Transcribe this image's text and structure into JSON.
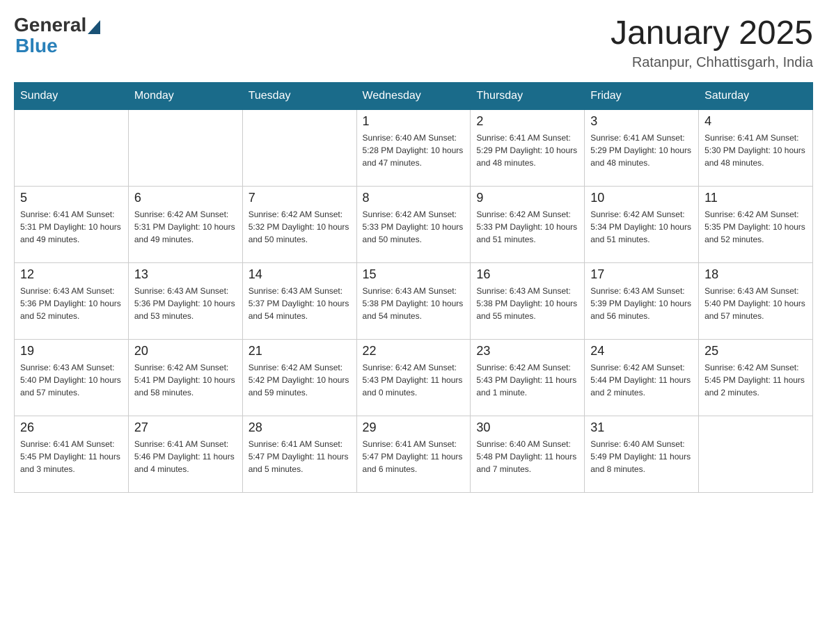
{
  "header": {
    "logo_general": "General",
    "logo_blue": "Blue",
    "month_title": "January 2025",
    "location": "Ratanpur, Chhattisgarh, India"
  },
  "days_of_week": [
    "Sunday",
    "Monday",
    "Tuesday",
    "Wednesday",
    "Thursday",
    "Friday",
    "Saturday"
  ],
  "weeks": [
    [
      {
        "day": "",
        "info": ""
      },
      {
        "day": "",
        "info": ""
      },
      {
        "day": "",
        "info": ""
      },
      {
        "day": "1",
        "info": "Sunrise: 6:40 AM\nSunset: 5:28 PM\nDaylight: 10 hours\nand 47 minutes."
      },
      {
        "day": "2",
        "info": "Sunrise: 6:41 AM\nSunset: 5:29 PM\nDaylight: 10 hours\nand 48 minutes."
      },
      {
        "day": "3",
        "info": "Sunrise: 6:41 AM\nSunset: 5:29 PM\nDaylight: 10 hours\nand 48 minutes."
      },
      {
        "day": "4",
        "info": "Sunrise: 6:41 AM\nSunset: 5:30 PM\nDaylight: 10 hours\nand 48 minutes."
      }
    ],
    [
      {
        "day": "5",
        "info": "Sunrise: 6:41 AM\nSunset: 5:31 PM\nDaylight: 10 hours\nand 49 minutes."
      },
      {
        "day": "6",
        "info": "Sunrise: 6:42 AM\nSunset: 5:31 PM\nDaylight: 10 hours\nand 49 minutes."
      },
      {
        "day": "7",
        "info": "Sunrise: 6:42 AM\nSunset: 5:32 PM\nDaylight: 10 hours\nand 50 minutes."
      },
      {
        "day": "8",
        "info": "Sunrise: 6:42 AM\nSunset: 5:33 PM\nDaylight: 10 hours\nand 50 minutes."
      },
      {
        "day": "9",
        "info": "Sunrise: 6:42 AM\nSunset: 5:33 PM\nDaylight: 10 hours\nand 51 minutes."
      },
      {
        "day": "10",
        "info": "Sunrise: 6:42 AM\nSunset: 5:34 PM\nDaylight: 10 hours\nand 51 minutes."
      },
      {
        "day": "11",
        "info": "Sunrise: 6:42 AM\nSunset: 5:35 PM\nDaylight: 10 hours\nand 52 minutes."
      }
    ],
    [
      {
        "day": "12",
        "info": "Sunrise: 6:43 AM\nSunset: 5:36 PM\nDaylight: 10 hours\nand 52 minutes."
      },
      {
        "day": "13",
        "info": "Sunrise: 6:43 AM\nSunset: 5:36 PM\nDaylight: 10 hours\nand 53 minutes."
      },
      {
        "day": "14",
        "info": "Sunrise: 6:43 AM\nSunset: 5:37 PM\nDaylight: 10 hours\nand 54 minutes."
      },
      {
        "day": "15",
        "info": "Sunrise: 6:43 AM\nSunset: 5:38 PM\nDaylight: 10 hours\nand 54 minutes."
      },
      {
        "day": "16",
        "info": "Sunrise: 6:43 AM\nSunset: 5:38 PM\nDaylight: 10 hours\nand 55 minutes."
      },
      {
        "day": "17",
        "info": "Sunrise: 6:43 AM\nSunset: 5:39 PM\nDaylight: 10 hours\nand 56 minutes."
      },
      {
        "day": "18",
        "info": "Sunrise: 6:43 AM\nSunset: 5:40 PM\nDaylight: 10 hours\nand 57 minutes."
      }
    ],
    [
      {
        "day": "19",
        "info": "Sunrise: 6:43 AM\nSunset: 5:40 PM\nDaylight: 10 hours\nand 57 minutes."
      },
      {
        "day": "20",
        "info": "Sunrise: 6:42 AM\nSunset: 5:41 PM\nDaylight: 10 hours\nand 58 minutes."
      },
      {
        "day": "21",
        "info": "Sunrise: 6:42 AM\nSunset: 5:42 PM\nDaylight: 10 hours\nand 59 minutes."
      },
      {
        "day": "22",
        "info": "Sunrise: 6:42 AM\nSunset: 5:43 PM\nDaylight: 11 hours\nand 0 minutes."
      },
      {
        "day": "23",
        "info": "Sunrise: 6:42 AM\nSunset: 5:43 PM\nDaylight: 11 hours\nand 1 minute."
      },
      {
        "day": "24",
        "info": "Sunrise: 6:42 AM\nSunset: 5:44 PM\nDaylight: 11 hours\nand 2 minutes."
      },
      {
        "day": "25",
        "info": "Sunrise: 6:42 AM\nSunset: 5:45 PM\nDaylight: 11 hours\nand 2 minutes."
      }
    ],
    [
      {
        "day": "26",
        "info": "Sunrise: 6:41 AM\nSunset: 5:45 PM\nDaylight: 11 hours\nand 3 minutes."
      },
      {
        "day": "27",
        "info": "Sunrise: 6:41 AM\nSunset: 5:46 PM\nDaylight: 11 hours\nand 4 minutes."
      },
      {
        "day": "28",
        "info": "Sunrise: 6:41 AM\nSunset: 5:47 PM\nDaylight: 11 hours\nand 5 minutes."
      },
      {
        "day": "29",
        "info": "Sunrise: 6:41 AM\nSunset: 5:47 PM\nDaylight: 11 hours\nand 6 minutes."
      },
      {
        "day": "30",
        "info": "Sunrise: 6:40 AM\nSunset: 5:48 PM\nDaylight: 11 hours\nand 7 minutes."
      },
      {
        "day": "31",
        "info": "Sunrise: 6:40 AM\nSunset: 5:49 PM\nDaylight: 11 hours\nand 8 minutes."
      },
      {
        "day": "",
        "info": ""
      }
    ]
  ]
}
